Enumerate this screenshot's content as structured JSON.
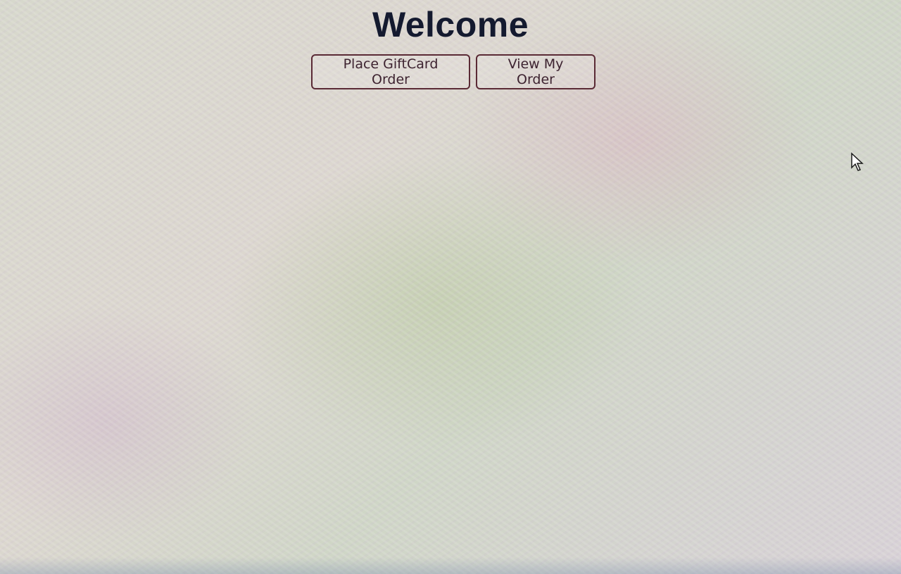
{
  "page": {
    "title": "Welcome"
  },
  "actions": {
    "place_order_label": "Place GiftCard Order",
    "view_order_label": "View My Order"
  },
  "colors": {
    "title": "#141a2f",
    "button_border": "#5a2a35",
    "button_text": "#3d2330"
  },
  "cursor": {
    "icon": "mouse-pointer-icon"
  }
}
